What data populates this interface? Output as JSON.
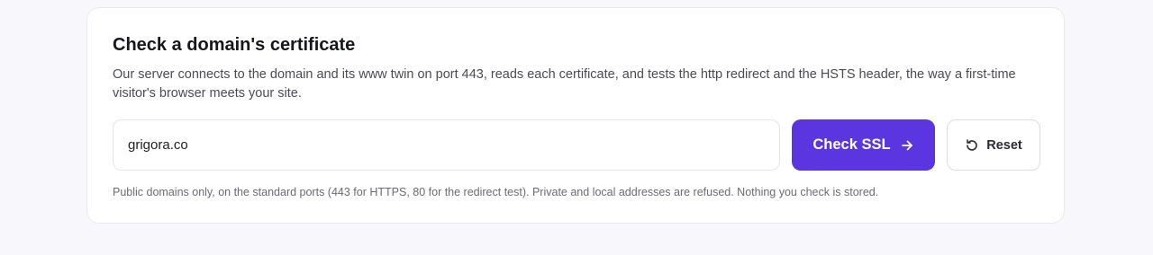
{
  "card": {
    "title": "Check a domain's certificate",
    "description": "Our server connects to the domain and its www twin on port 443, reads each certificate, and tests the http redirect and the HSTS header, the way a first-time visitor's browser meets your site.",
    "note": "Public domains only, on the standard ports (443 for HTTPS, 80 for the redirect test). Private and local addresses are refused. Nothing you check is stored."
  },
  "form": {
    "domain_value": "grigora.co",
    "check_label": "Check SSL",
    "check_icon": "arrow-right-icon",
    "reset_label": "Reset",
    "reset_icon": "rotate-ccw-icon"
  },
  "colors": {
    "accent": "#5b35e0",
    "background": "#f8f8fc",
    "card": "#ffffff",
    "border": "#e4e4ec"
  }
}
